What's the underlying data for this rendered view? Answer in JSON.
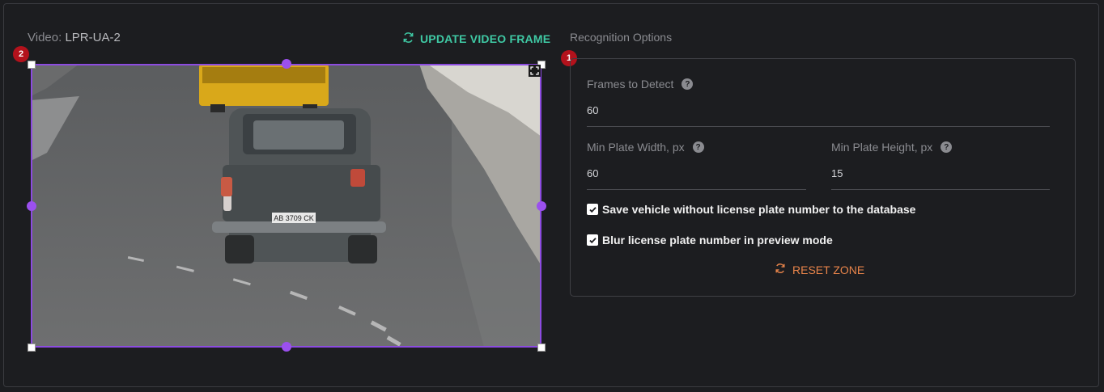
{
  "video": {
    "prefix": "Video:",
    "name": "LPR-UA-2"
  },
  "update_button": {
    "label": "UPDATE VIDEO FRAME",
    "icon": "refresh-icon"
  },
  "frame": {
    "plate_text": "AB 3709 CK"
  },
  "badges": {
    "options": "1",
    "zone": "2"
  },
  "options": {
    "title": "Recognition Options",
    "frames_to_detect": {
      "label": "Frames to Detect",
      "value": "60"
    },
    "min_plate_width": {
      "label": "Min Plate Width, px",
      "value": "60"
    },
    "min_plate_height": {
      "label": "Min Plate Height, px",
      "value": "15"
    },
    "save_without_plate": {
      "label": "Save vehicle without license plate number to the database",
      "checked": true
    },
    "blur_plate": {
      "label": "Blur license plate number in preview mode",
      "checked": true
    },
    "reset_label": "RESET ZONE"
  },
  "colors": {
    "accent_green": "#3fc9a4",
    "accent_orange": "#e8844a",
    "zone_purple": "#8c4be0",
    "badge_red": "#b3121c"
  }
}
